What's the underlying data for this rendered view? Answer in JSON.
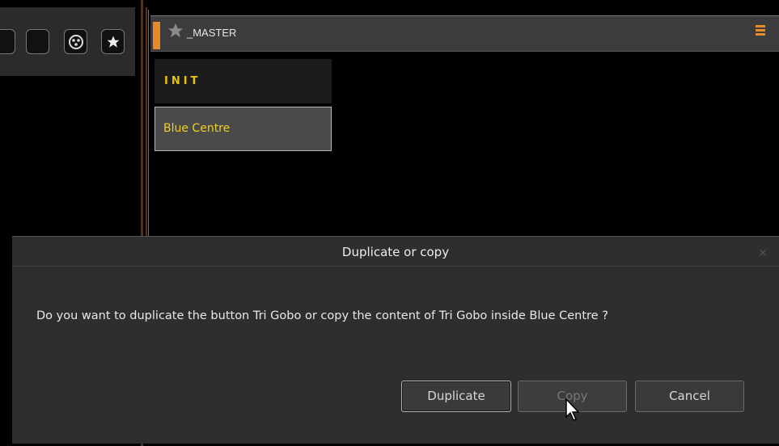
{
  "toolbar": {
    "buttons": [
      {
        "icon": "blank-icon"
      },
      {
        "icon": "blank-icon"
      },
      {
        "icon": "gobo-icon"
      },
      {
        "icon": "star-icon"
      }
    ]
  },
  "master": {
    "title": "_MASTER",
    "accent_color": "#e8892a",
    "items": [
      {
        "label": "INIT"
      },
      {
        "label": "Blue Centre"
      }
    ]
  },
  "dialog": {
    "title": "Duplicate or copy",
    "close": "×",
    "message": "Do you want to duplicate the button Tri Gobo or copy the content of Tri Gobo inside Blue Centre ?",
    "buttons": {
      "duplicate": "Duplicate",
      "copy": "Copy",
      "cancel": "Cancel"
    }
  }
}
